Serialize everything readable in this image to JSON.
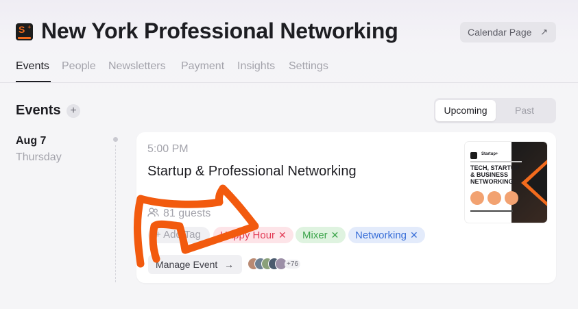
{
  "header": {
    "title": "New York Professional Networking",
    "calendar_button": "Calendar Page",
    "calendar_arrow": "↗",
    "tabs": [
      {
        "label": "Events",
        "active": true
      },
      {
        "label": "People",
        "active": false
      },
      {
        "label": "Newsletters",
        "active": false
      },
      {
        "label": "Payment",
        "active": false
      },
      {
        "label": "Insights",
        "active": false
      },
      {
        "label": "Settings",
        "active": false
      }
    ]
  },
  "events_section": {
    "heading": "Events",
    "add_symbol": "+",
    "filter": {
      "options": [
        "Upcoming",
        "Past"
      ],
      "selected": "Upcoming"
    }
  },
  "event": {
    "date": "Aug 7",
    "weekday": "Thursday",
    "time": "5:00 PM",
    "title": "Startup & Professional Networking",
    "guests": "81 guests",
    "tags": [
      {
        "label": "Happy Hour",
        "color": "#e23b55"
      },
      {
        "label": "Mixer",
        "color": "#3ba44a"
      },
      {
        "label": "Networking",
        "color": "#3a6fd8"
      }
    ],
    "add_tag": "+ Add Tag",
    "remove_symbol": "✕",
    "manage_button": "Manage Event",
    "manage_arrow": "→",
    "extra_guests": "+76",
    "thumbnail": {
      "brand": "Startup+",
      "headline": "TECH, STARTUP & BUSINESS NETWORKING"
    }
  },
  "colors": {
    "annotation": "#f25a0e",
    "accent_orange": "#f26b1d"
  }
}
